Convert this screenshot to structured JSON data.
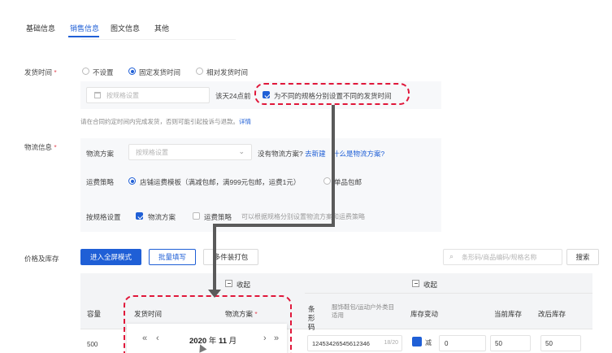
{
  "tabs": [
    {
      "label": "基础信息",
      "active": false
    },
    {
      "label": "销售信息",
      "active": true
    },
    {
      "label": "图文信息",
      "active": false
    },
    {
      "label": "其他",
      "active": false
    }
  ],
  "ship_time": {
    "label": "发货时间",
    "required_mark": "*",
    "options": [
      {
        "label": "不设置",
        "selected": false
      },
      {
        "label": "固定发货时间",
        "selected": true
      },
      {
        "label": "相对发货时间",
        "selected": false
      }
    ],
    "input_placeholder": "按规格设置",
    "suffix": "该天24点前",
    "per_spec_checkbox_label": "为不同的规格分别设置不同的发货时间",
    "per_spec_checked": true,
    "hint": "请在合同约定时间内完成发货，否则可能引起投诉与退款。",
    "hint_link": "详情"
  },
  "logistics": {
    "label": "物流信息",
    "required_mark": "*",
    "plan_label": "物流方案",
    "plan_placeholder": "按规格设置",
    "no_plan_text": "没有物流方案?",
    "create_link": "去新建",
    "what_link": "什么是物流方案?",
    "freight_label": "运费策略",
    "freight_options": [
      {
        "label": "店铺运费模板（满减包邮，满999元包邮，运费1元）",
        "selected": true
      },
      {
        "label": "单品包邮",
        "selected": false
      }
    ],
    "by_spec_label": "按规格设置",
    "by_spec_options": [
      {
        "label": "物流方案",
        "checked": true
      },
      {
        "label": "运费策略",
        "checked": false
      }
    ],
    "by_spec_hint": "可以根据规格分别设置物流方案和运费策略"
  },
  "price_stock": {
    "label": "价格及库存",
    "fullscreen_button": "进入全屏模式",
    "batch_button": "批量填写",
    "multi_pack_button": "多件装打包",
    "search_placeholder": "条形码/商品编码/规格名称",
    "search_button": "搜索",
    "group_collapse_1": "收起",
    "group_collapse_2": "收起",
    "columns": [
      "容量",
      "发货时间",
      "物流方案",
      "条形码",
      "服饰鞋包/运动户外类目适用",
      "库存变动",
      "当前库存",
      "改后库存"
    ],
    "logistics_required": "*",
    "row": {
      "capacity": "500",
      "barcode": "12453426545612346",
      "barcode_count": "18/20",
      "stock_change_op": "减",
      "stock_change_value": "0",
      "current_stock": "50",
      "new_stock": "50"
    }
  },
  "date_picker": {
    "year": "2020",
    "year_unit": "年",
    "month": "11",
    "month_unit": "月",
    "prev_year": "«",
    "prev_month": "‹",
    "next_month": "›",
    "next_year": "»"
  },
  "colors": {
    "accent": "#1f5fd6",
    "annotation": "#e0173a"
  }
}
